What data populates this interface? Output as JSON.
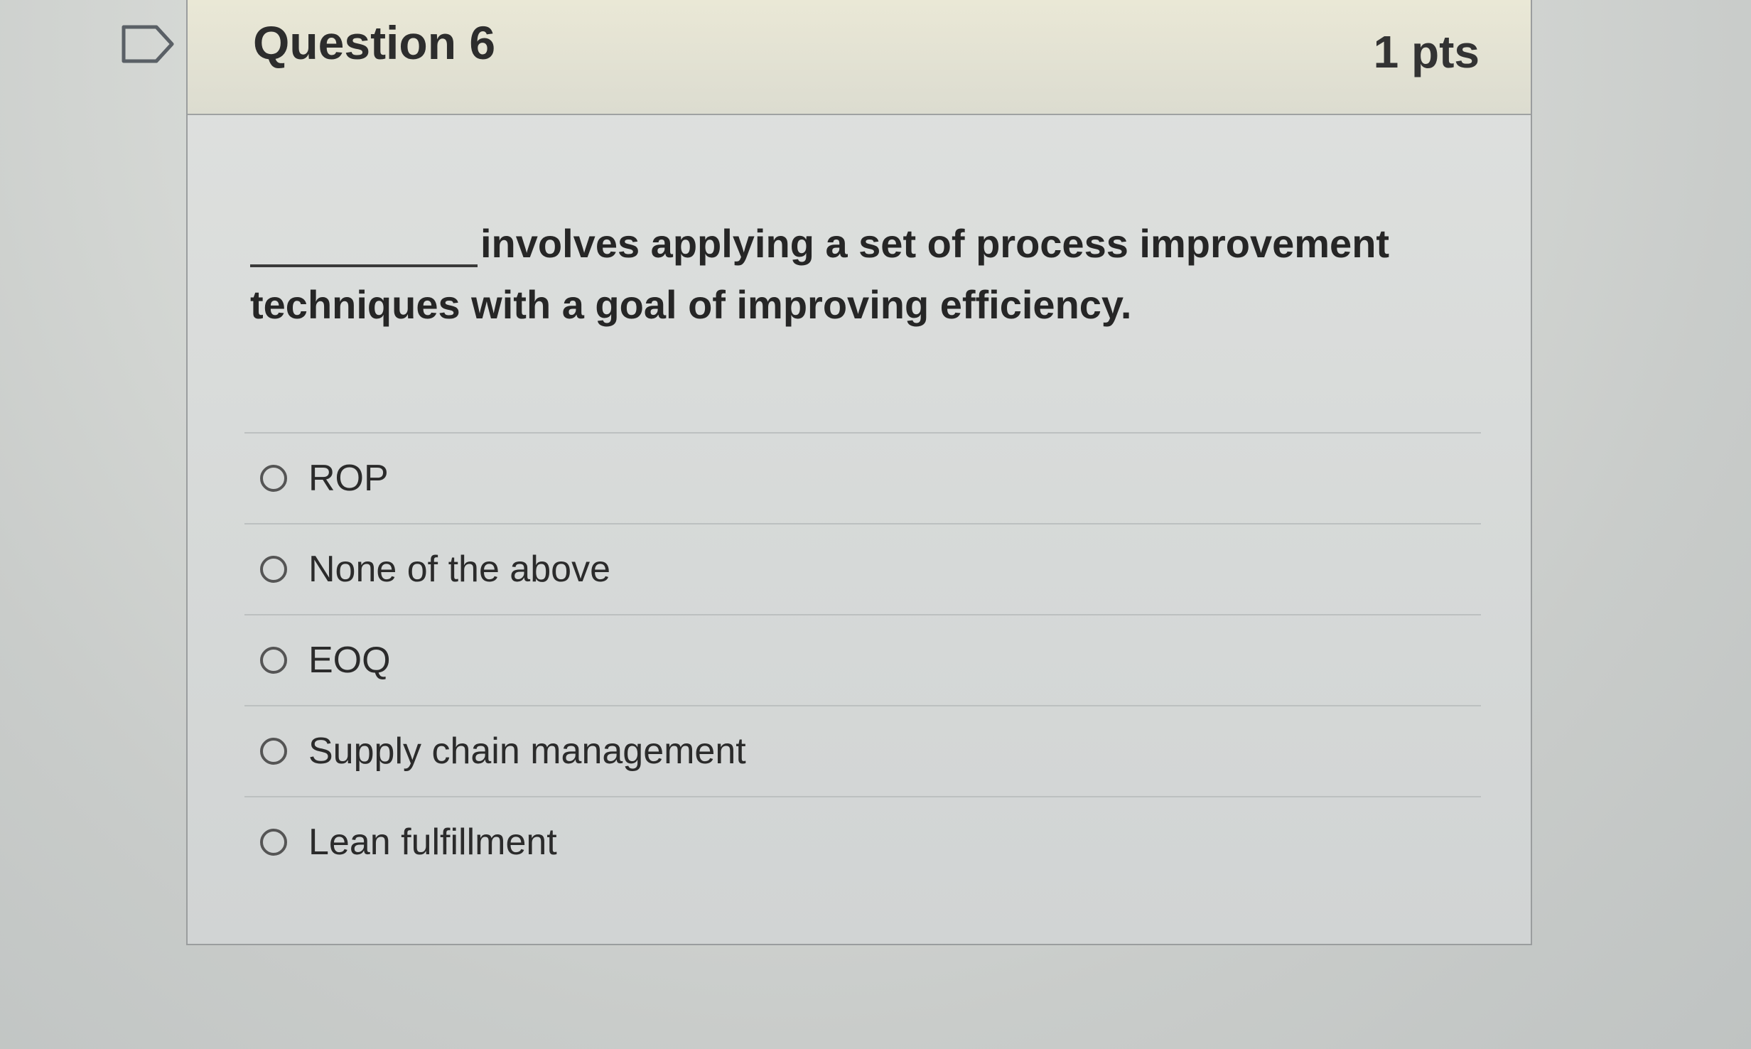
{
  "question": {
    "title": "Question 6",
    "points": "1 pts",
    "text": "involves applying a set of process improvement techniques with a goal of improving efficiency.",
    "flag_icon": "bookmark-flag-icon"
  },
  "answers": [
    {
      "label": "ROP"
    },
    {
      "label": "None of the above"
    },
    {
      "label": "EOQ"
    },
    {
      "label": "Supply chain management"
    },
    {
      "label": "Lean fulfillment"
    }
  ]
}
